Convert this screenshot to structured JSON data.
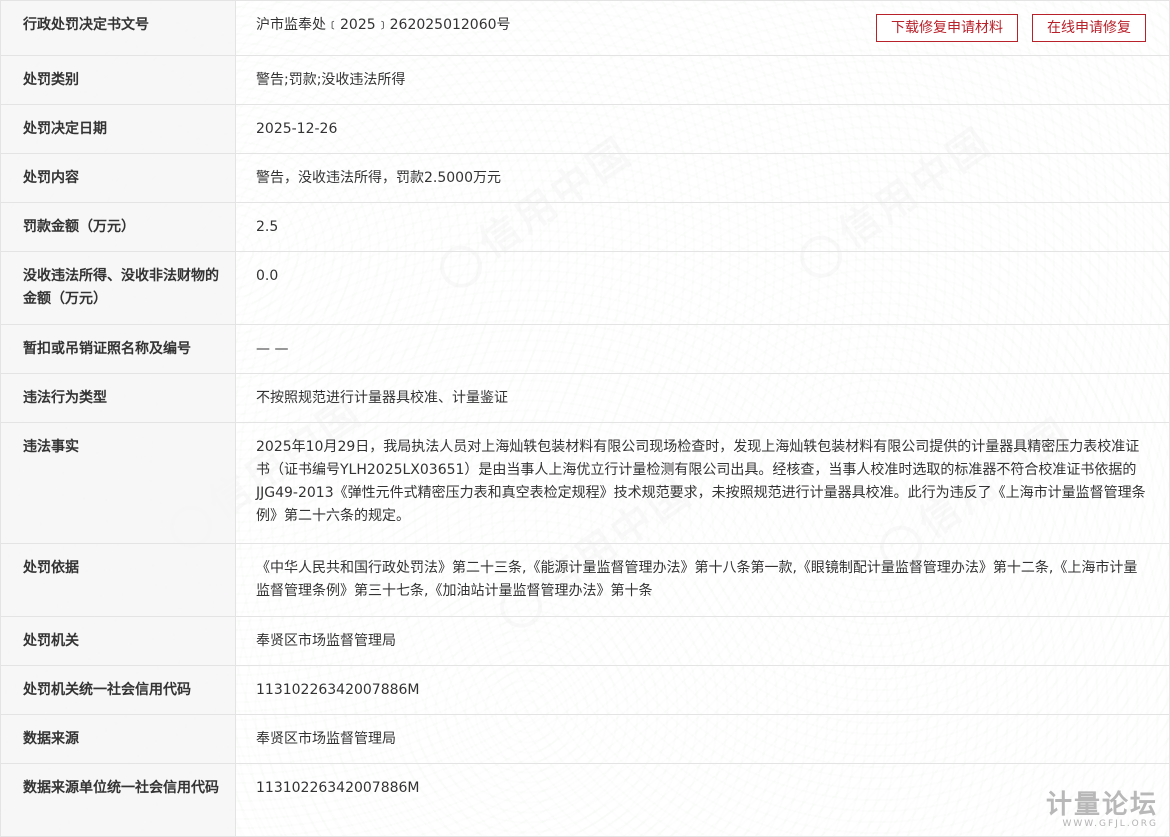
{
  "actions": {
    "download_label": "下载修复申请材料",
    "online_label": "在线申请修复"
  },
  "watermark_text": "信用中国",
  "rows": [
    {
      "label": "行政处罚决定书文号",
      "value": "沪市监奉处﹝2025﹞262025012060号"
    },
    {
      "label": "处罚类别",
      "value": "警告;罚款;没收违法所得"
    },
    {
      "label": "处罚决定日期",
      "value": "2025-12-26"
    },
    {
      "label": "处罚内容",
      "value": "警告，没收违法所得，罚款2.5000万元"
    },
    {
      "label": "罚款金额（万元）",
      "value": "2.5"
    },
    {
      "label": "没收违法所得、没收非法财物的金额（万元）",
      "value": "0.0"
    },
    {
      "label": "暂扣或吊销证照名称及编号",
      "value": "— —"
    },
    {
      "label": "违法行为类型",
      "value": "不按照规范进行计量器具校准、计量鉴证"
    },
    {
      "label": "违法事实",
      "value": "2025年10月29日，我局执法人员对上海灿轶包装材料有限公司现场检查时，发现上海灿轶包装材料有限公司提供的计量器具精密压力表校准证书（证书编号YLH2025LX03651）是由当事人上海优立行计量检测有限公司出具。经核查，当事人校准时选取的标准器不符合校准证书依据的JJG49-2013《弹性元件式精密压力表和真空表检定规程》技术规范要求，未按照规范进行计量器具校准。此行为违反了《上海市计量监督管理条例》第二十六条的规定。"
    },
    {
      "label": "处罚依据",
      "value": "《中华人民共和国行政处罚法》第二十三条,《能源计量监督管理办法》第十八条第一款,《眼镜制配计量监督管理办法》第十二条,《上海市计量监督管理条例》第三十七条,《加油站计量监督管理办法》第十条"
    },
    {
      "label": "处罚机关",
      "value": "奉贤区市场监督管理局"
    },
    {
      "label": "处罚机关统一社会信用代码",
      "value": "11310226342007886M"
    },
    {
      "label": "数据来源",
      "value": "奉贤区市场监督管理局"
    },
    {
      "label": "数据来源单位统一社会信用代码",
      "value": "11310226342007886M"
    }
  ],
  "footer_logo": {
    "main": "计量论坛",
    "sub": "WWW.GFJL.ORG"
  }
}
